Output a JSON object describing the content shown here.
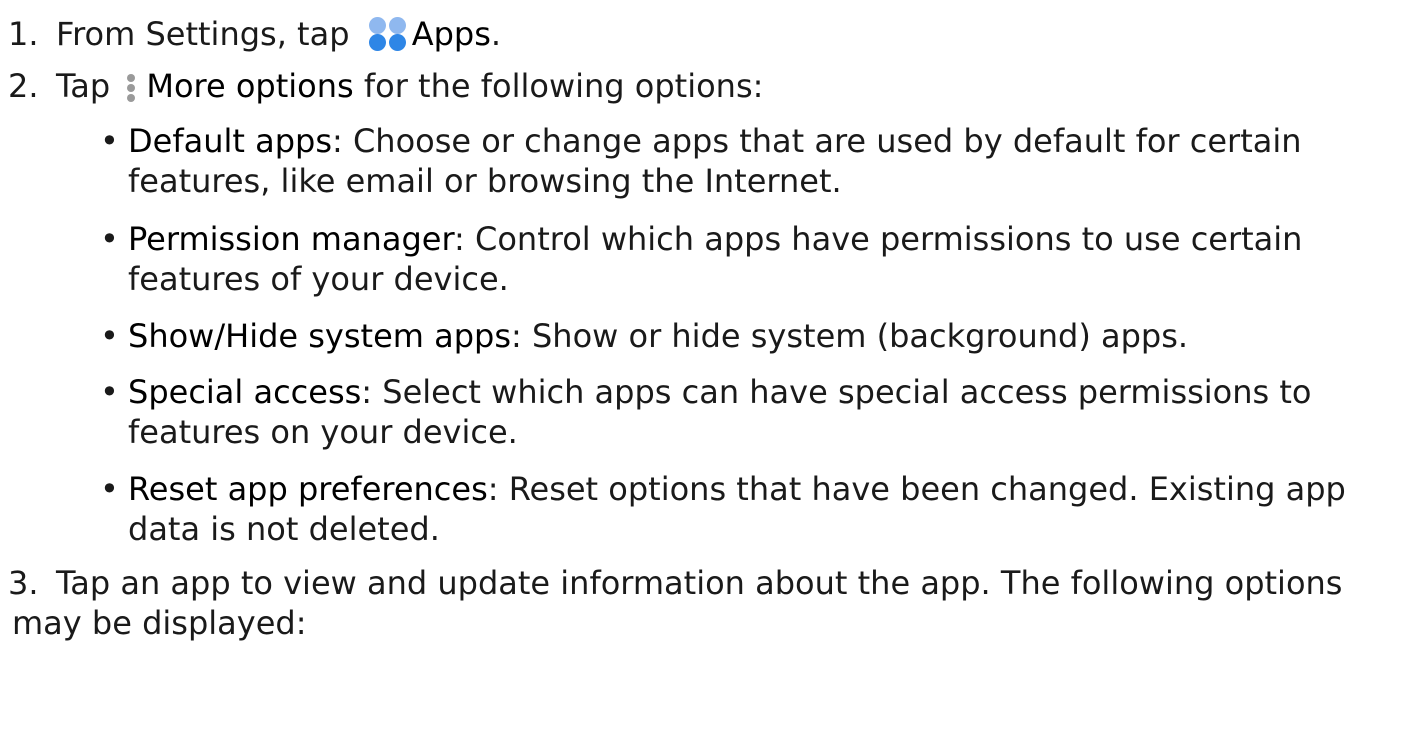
{
  "colors": {
    "apps_icon_light": "#8fb8ef",
    "apps_icon_dark": "#2e86e6",
    "more_icon": "#9a9a9a"
  },
  "icons": {
    "apps": "apps-icon",
    "more_options": "more-options-icon"
  },
  "steps": [
    {
      "num": "1.",
      "pre": "From Settings, tap",
      "term": "Apps",
      "post": "."
    },
    {
      "num": "2.",
      "pre": "Tap",
      "term": "More options",
      "post": " for the following options:"
    },
    {
      "num": "3.",
      "text_line1": "Tap an app to view and update information about the app. The following options",
      "text_line2": "may be displayed:"
    }
  ],
  "bullets": [
    {
      "term": "Default apps",
      "line1_rest": ": Choose or change apps that are used by default for certain",
      "line2": "features, like email or browsing the Internet."
    },
    {
      "term": "Permission manager",
      "line1_rest": ": Control which apps have permissions to use certain",
      "line2": "features of your device."
    },
    {
      "term": "Show/Hide system apps",
      "line1_rest": ": Show or hide system (background) apps.",
      "line2": ""
    },
    {
      "term": "Special access",
      "line1_rest": ": Select which apps can have special access permissions to",
      "line2": "features on your device."
    },
    {
      "term": "Reset app preferences",
      "line1_rest": ": Reset options that have been changed. Existing app",
      "line2": "data is not deleted."
    }
  ],
  "bullet_char": "•"
}
